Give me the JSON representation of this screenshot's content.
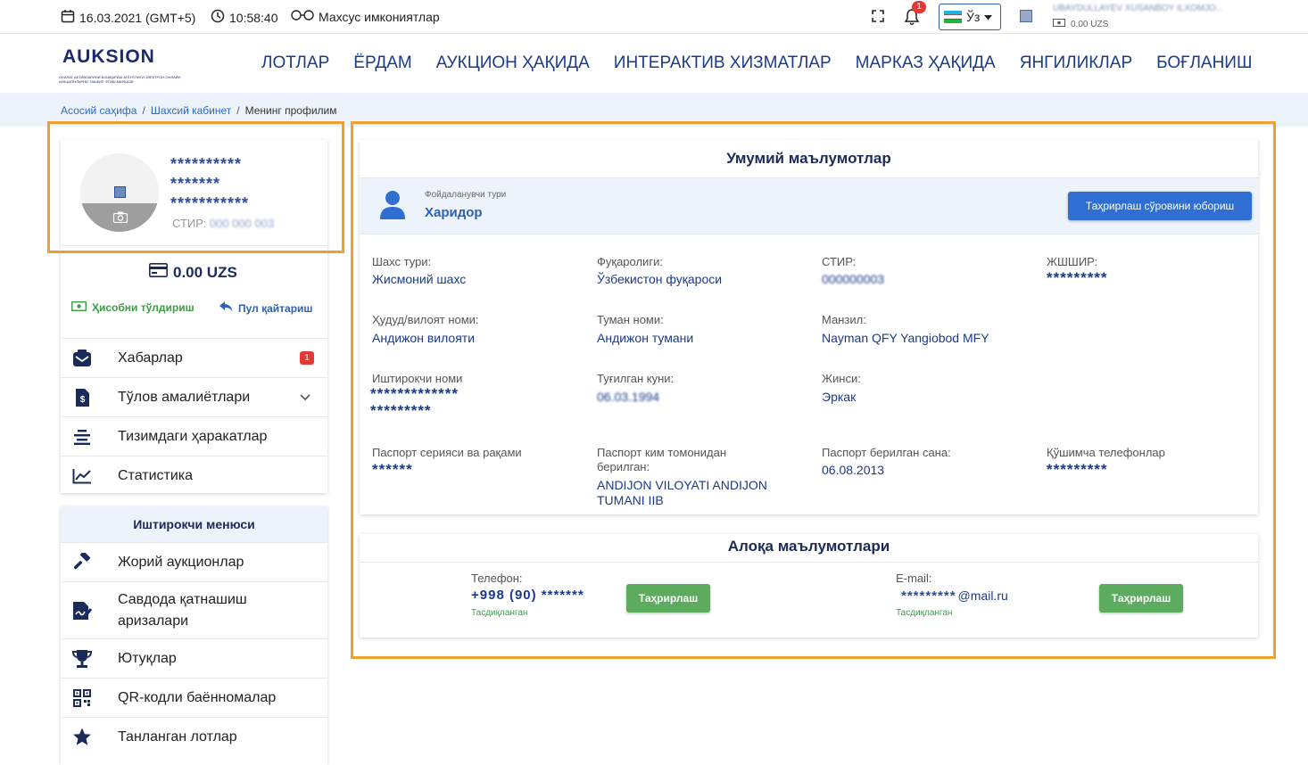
{
  "topbar": {
    "date": "16.03.2021 (GMT+5)",
    "time": "10:58:40",
    "special": "Махсус имкониятлар",
    "notif_count": "1",
    "lang": "Ўз",
    "user_name": "UBAYDULLAYEV XUSANBOY ILXOMJO...",
    "balance": "0.00 UZS"
  },
  "logo": {
    "name": "AUKSION",
    "sub": "ОХИЛАТ АКТИВЛАРИНИ БОШҚАРИШ АГЕНТЛИГИ ЭЛЕКТРОН-ОНЛАЙН АУКЦИОНЛАРНИ ТАШКИЛ ЭТИШ МАРКАЗИ"
  },
  "nav": [
    "ЛОТЛАР",
    "ЁРДАМ",
    "АУКЦИОН ҲАҚИДА",
    "ИНТЕРАКТИВ ХИЗМАТЛАР",
    "МАРКАЗ ҲАҚИДА",
    "ЯНГИЛИКЛАР",
    "БОҒЛАНИШ"
  ],
  "breadcrumb": {
    "home": "Асосий саҳифа",
    "cabinet": "Шахсий кабинет",
    "current": "Менинг профилим",
    "sep": "/"
  },
  "profile": {
    "line1": "**********",
    "line2": "*******",
    "line3": "***********",
    "stir_label": "СТИР:",
    "stir_value": "000 000 003",
    "balance": "0.00 UZS",
    "topup": "Ҳисобни тўлдириш",
    "refund": "Пул қайтариш"
  },
  "menu": [
    {
      "label": "Хабарлар",
      "badge": "1"
    },
    {
      "label": "Тўлов амалиётлари"
    },
    {
      "label": "Тизимдаги ҳаракатлар"
    },
    {
      "label": "Статистика"
    }
  ],
  "participant_menu": {
    "title": "Иштирокчи менюси",
    "items": [
      "Жорий аукционлар",
      "Савдода қатнашиш аризалари",
      "Ютуқлар",
      "QR-кодли баённомалар",
      "Танланган лотлар"
    ]
  },
  "general": {
    "title": "Умумий маълумотлар",
    "user_type_label": "Фойдаланувчи тури",
    "user_type": "Харидор",
    "edit_request_btn": "Таҳрирлаш сўровини юбориш",
    "fields": [
      {
        "label": "Шахс тури:",
        "value": "Жисмоний шахс"
      },
      {
        "label": "Фуқаролиги:",
        "value": "Ўзбекистон фуқароси"
      },
      {
        "label": "СТИР:",
        "value": "000000003"
      },
      {
        "label": "ЖШШИР:",
        "value": "*********"
      },
      {
        "label": "Ҳудуд/вилоят номи:",
        "value": "Андижон вилояти"
      },
      {
        "label": "Туман номи:",
        "value": "Андижон тумани"
      },
      {
        "label": "Манзил:",
        "value": "Nayman QFY Yangiobod MFY"
      },
      {
        "label": "Иштирокчи номи",
        "value": "*************",
        "value2": "*********"
      },
      {
        "label": "Туғилган куни:",
        "value": "06.03.1994"
      },
      {
        "label": "Жинси:",
        "value": "Эркак"
      },
      {
        "label": "Паспорт серияси ва рақами",
        "value": "******"
      },
      {
        "label": "Паспорт ким томонидан берилган:",
        "value": "ANDIJON VILOYATI ANDIJON TUMANI IIB"
      },
      {
        "label": "Паспорт берилган сана:",
        "value": "06.08.2013"
      },
      {
        "label": "Қўшимча телефонлар",
        "value": "*********"
      }
    ]
  },
  "contact": {
    "title": "Алоқа маълумотлари",
    "phone_label": "Телефон:",
    "phone_value": "+998 (90) *******",
    "phone_status": "Тасдиқланган",
    "email_label": "E-mail:",
    "email_stars": "*********",
    "email_domain": "@mail.ru",
    "email_status": "Тасдиқланган",
    "edit_btn": "Таҳрирлаш"
  }
}
